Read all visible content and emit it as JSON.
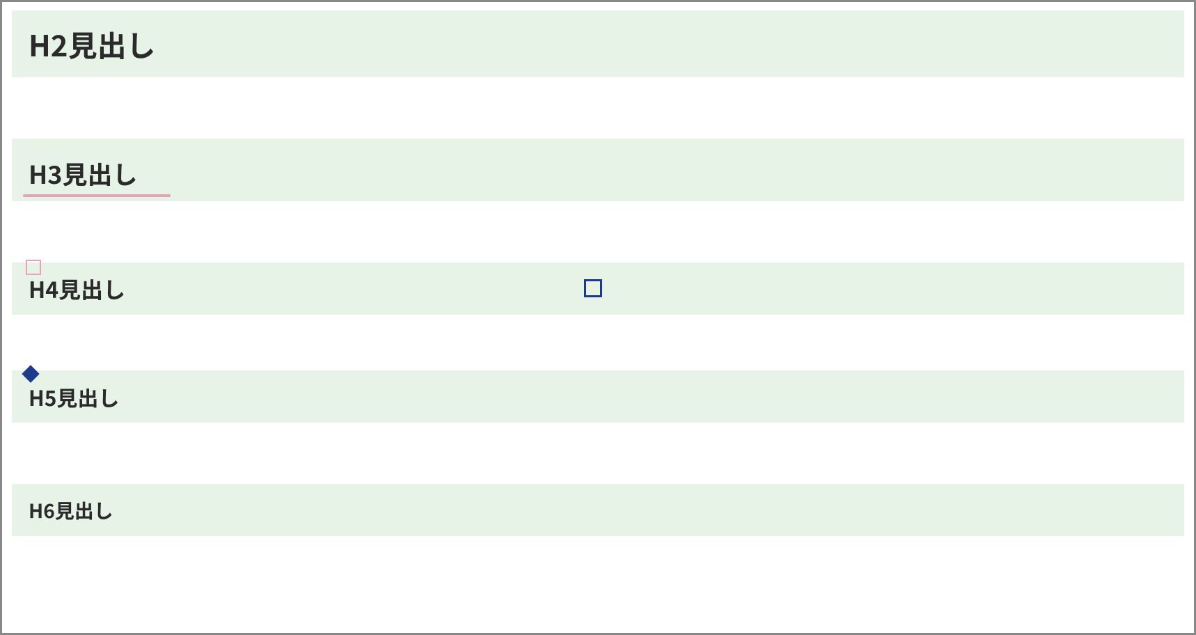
{
  "headings": {
    "h2": "H2見出し",
    "h3": "H3見出し",
    "h4": "H4見出し",
    "h5": "H5見出し",
    "h6": "H6見出し"
  },
  "colors": {
    "block_bg": "#e8f3e8",
    "text": "#2a2a2a",
    "pink_accent": "#e6a3b3",
    "blue_accent": "#1e3a8a",
    "frame_border": "#888888"
  }
}
